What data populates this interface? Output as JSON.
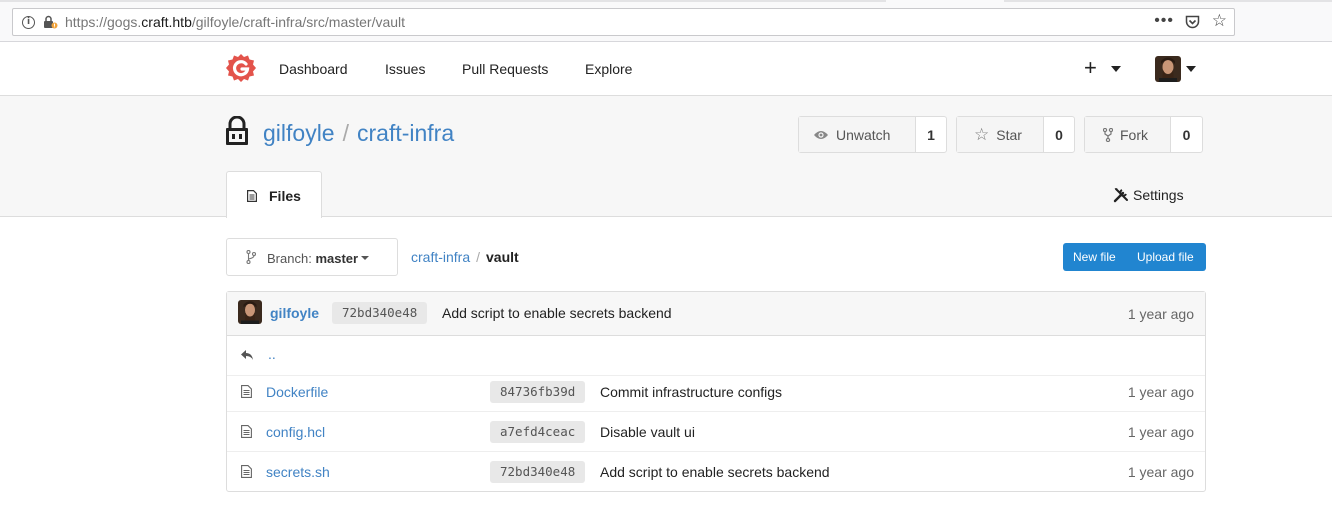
{
  "browser": {
    "url_prefix": "https://gogs.",
    "url_domain": "craft.htb",
    "url_path": "/gilfoyle/craft-infra/src/master/vault",
    "more_label": "•••"
  },
  "nav": {
    "items": [
      {
        "label": "Dashboard"
      },
      {
        "label": "Issues"
      },
      {
        "label": "Pull Requests"
      },
      {
        "label": "Explore"
      }
    ],
    "plus_label": "+"
  },
  "repo": {
    "owner": "gilfoyle",
    "separator": "/",
    "name": "craft-infra",
    "watch": {
      "label": "Unwatch",
      "count": "1"
    },
    "star": {
      "label": "Star",
      "count": "0"
    },
    "fork": {
      "label": "Fork",
      "count": "0"
    }
  },
  "tabs": {
    "files": "Files",
    "settings": "Settings"
  },
  "toolbar": {
    "branch_prefix": "Branch:",
    "branch_name": "master",
    "breadcrumb_root": "craft-infra",
    "breadcrumb_sep": "/",
    "breadcrumb_current": "vault",
    "new_file": "New file",
    "upload_file": "Upload file"
  },
  "latest_commit": {
    "author": "gilfoyle",
    "sha": "72bd340e48",
    "message": "Add script to enable secrets backend",
    "age": "1 year ago"
  },
  "parent_dir": "..",
  "files": [
    {
      "name": "Dockerfile",
      "sha": "84736fb39d",
      "message": "Commit infrastructure configs",
      "age": "1 year ago"
    },
    {
      "name": "config.hcl",
      "sha": "a7efd4ceac",
      "message": "Disable vault ui",
      "age": "1 year ago"
    },
    {
      "name": "secrets.sh",
      "sha": "72bd340e48",
      "message": "Add script to enable secrets backend",
      "age": "1 year ago"
    }
  ],
  "colors": {
    "link": "#4183c4",
    "primary_button": "#2185d0",
    "logo": "#e3534b"
  }
}
